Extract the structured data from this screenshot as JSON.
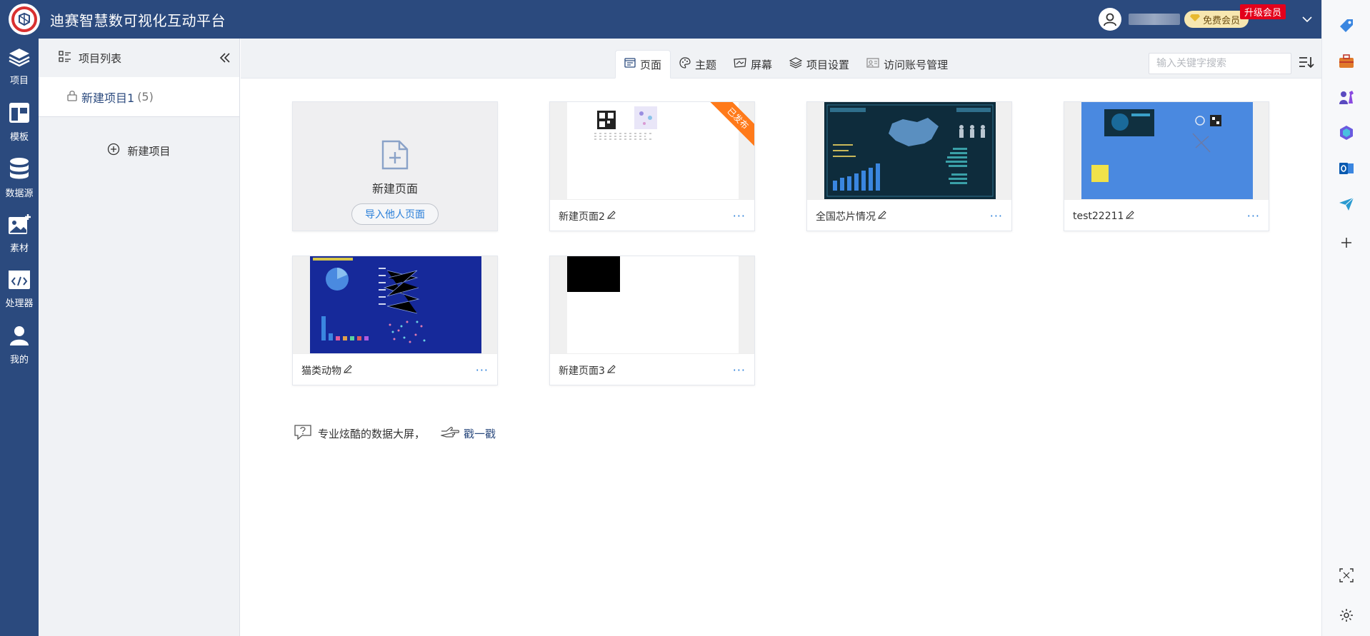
{
  "app": {
    "title": "迪赛智慧数可视化互动平台"
  },
  "header": {
    "vip_label": "免费会员",
    "upgrade_label": "升级会员"
  },
  "leftnav": {
    "items": [
      {
        "label": "项目",
        "icon": "layers-icon"
      },
      {
        "label": "模板",
        "icon": "template-icon"
      },
      {
        "label": "数据源",
        "icon": "database-icon"
      },
      {
        "label": "素材",
        "icon": "image-add-icon"
      },
      {
        "label": "处理器",
        "icon": "code-icon"
      },
      {
        "label": "我的",
        "icon": "user-icon"
      }
    ]
  },
  "project_panel": {
    "title": "项目列表",
    "projects": [
      {
        "name": "新建项目1",
        "count": "(5)"
      }
    ],
    "new_project_label": "新建项目"
  },
  "tabs": [
    {
      "label": "页面",
      "icon": "page-icon",
      "active": true
    },
    {
      "label": "主题",
      "icon": "palette-icon",
      "active": false
    },
    {
      "label": "屏幕",
      "icon": "screen-icon",
      "active": false
    },
    {
      "label": "项目设置",
      "icon": "stack-icon",
      "active": false
    },
    {
      "label": "访问账号管理",
      "icon": "account-icon",
      "active": false
    }
  ],
  "search": {
    "placeholder": "输入关键字搜索"
  },
  "new_page_card": {
    "label": "新建页面",
    "import_label": "导入他人页面"
  },
  "pages": [
    {
      "name": "新建页面2",
      "badge": "已发布"
    },
    {
      "name": "全国芯片情况"
    },
    {
      "name": "test22211"
    },
    {
      "name": "猫类动物"
    },
    {
      "name": "新建页面3"
    }
  ],
  "more_label": "···",
  "tip": {
    "text": "专业炫酷的数据大屏，",
    "link": "戳一戳"
  },
  "colors": {
    "primary": "#2b4a7e",
    "accent": "#2a7fd9",
    "ribbon": "#ff7a1a",
    "upgrade": "#e3001b"
  }
}
